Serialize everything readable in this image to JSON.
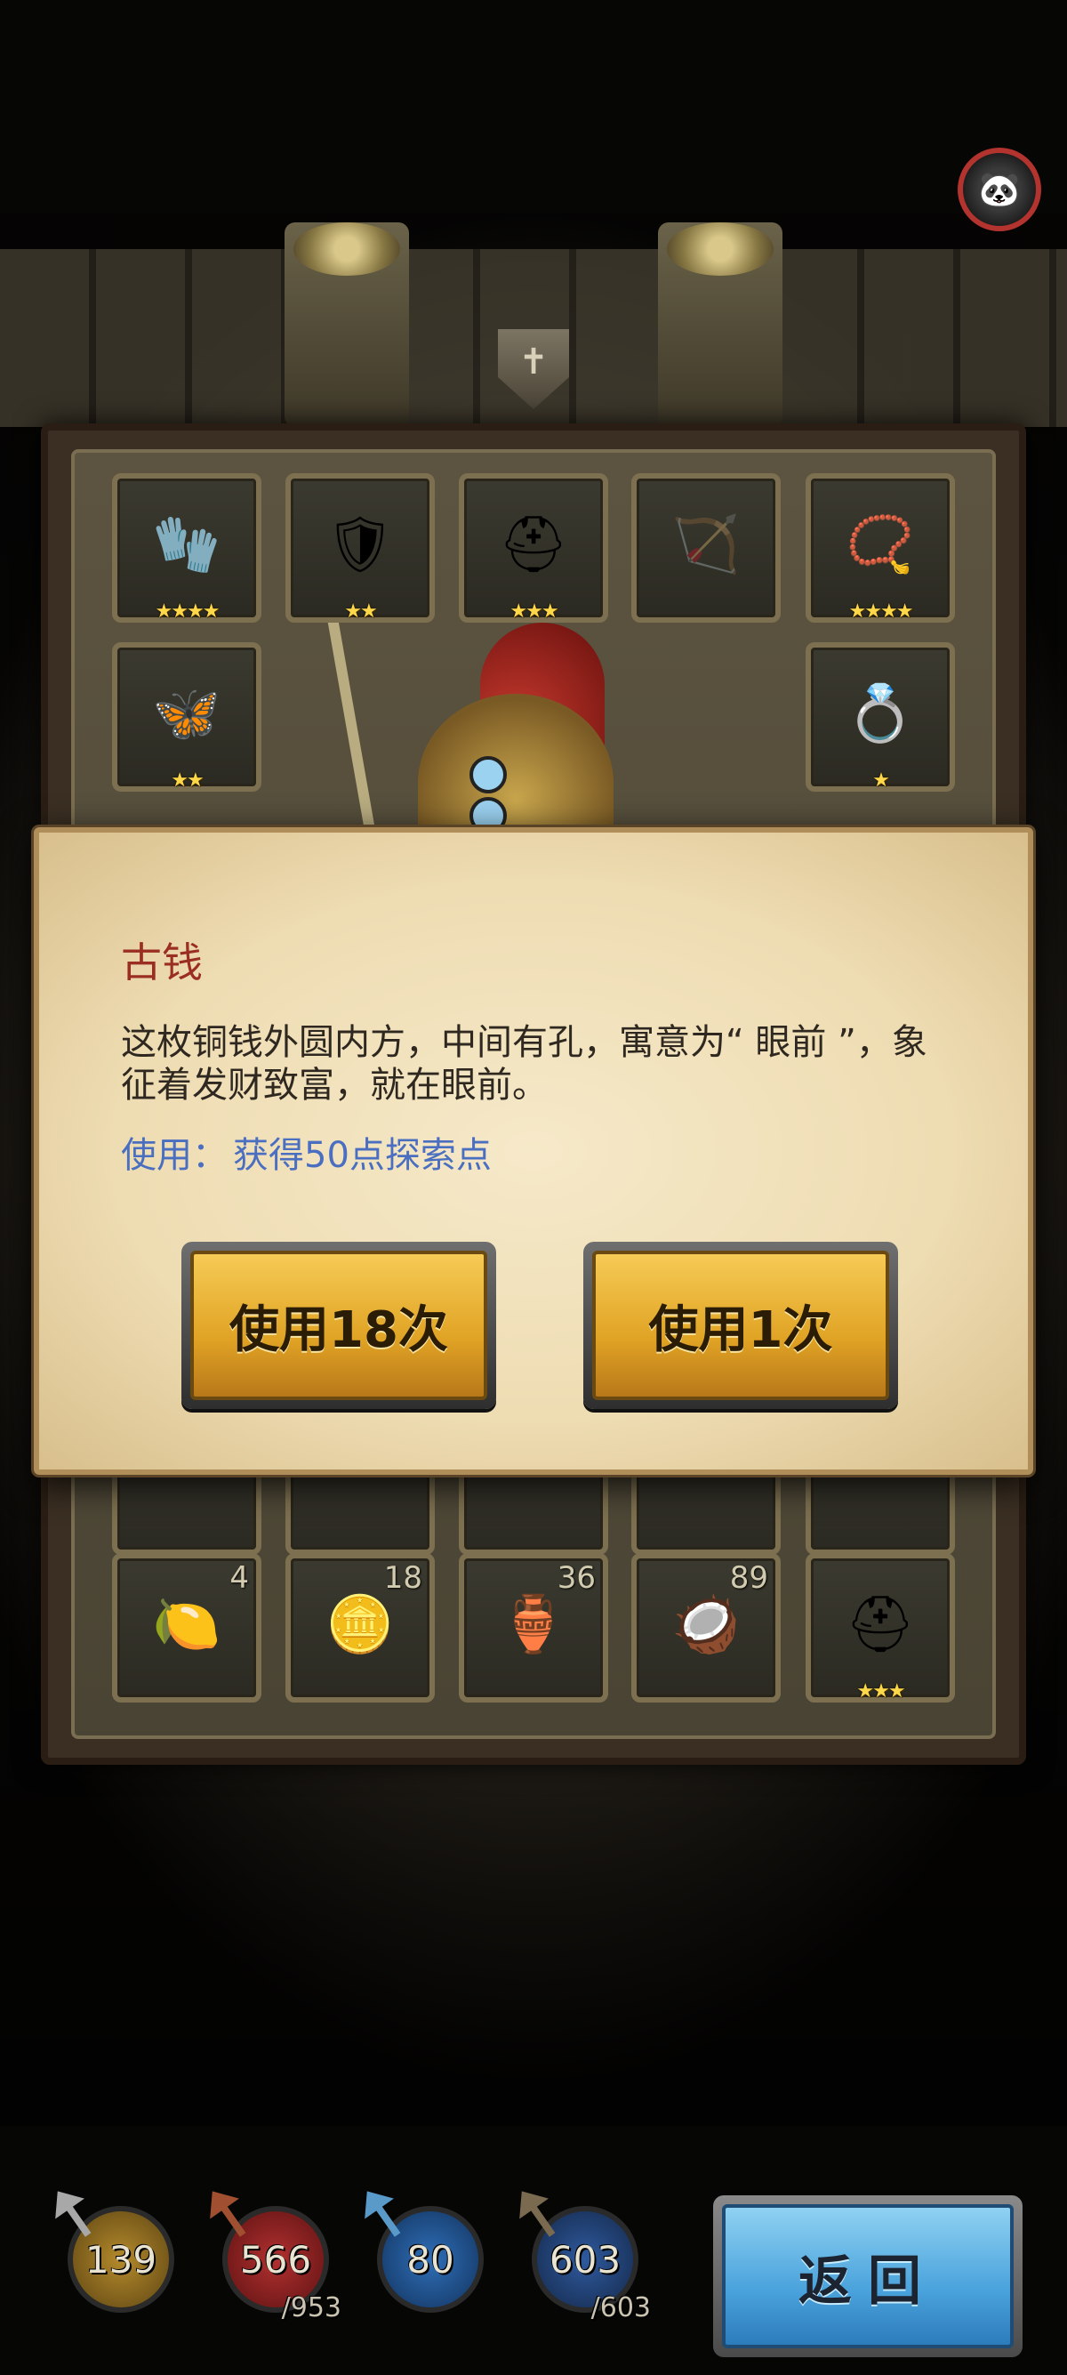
{
  "profile": {
    "icon": "panda-avatar-icon",
    "glyph": "🐼"
  },
  "equipment": [
    {
      "name": "gauntlet-icon",
      "glyph": "🧤",
      "stars": "★★★★"
    },
    {
      "name": "chest-armor-icon",
      "glyph": "🛡",
      "stars": "★★"
    },
    {
      "name": "spartan-helmet-icon",
      "glyph": "⛑",
      "stars": "★★★"
    },
    {
      "name": "crossbow-slot-icon",
      "glyph": "🏹",
      "stars": ""
    },
    {
      "name": "amulet-icon",
      "glyph": "📿",
      "stars": "★★★★"
    },
    {
      "name": "shoulder-armor-icon",
      "glyph": "🦋",
      "stars": "★★"
    },
    {
      "name": "ring-icon",
      "glyph": "💍",
      "stars": "★"
    }
  ],
  "inventory": [
    {
      "name": "buddha-hand-fruit-icon",
      "glyph": "🍋",
      "count": "4",
      "stars": ""
    },
    {
      "name": "ancient-coin-icon",
      "glyph": "🪙",
      "count": "18",
      "stars": ""
    },
    {
      "name": "vase-icon",
      "glyph": "🏺",
      "count": "36",
      "stars": ""
    },
    {
      "name": "bowl-icon",
      "glyph": "🥥",
      "count": "89",
      "stars": ""
    },
    {
      "name": "spartan-helmet-icon",
      "glyph": "⛑",
      "count": "",
      "stars": "★★★"
    }
  ],
  "dialog": {
    "title": "古钱",
    "description": "这枚铜钱外圆内方，中间有孔，寓意为“ 眼前 ”，象征着发财致富，就在眼前。",
    "use_label": "使用：",
    "use_value": "获得50点探索点",
    "btn_use_many": "使用18次",
    "btn_use_one": "使用1次"
  },
  "stats": [
    {
      "name": "attack-stat",
      "value": "139",
      "max": "",
      "color": "#8a6a1e",
      "pin": "#a8a8a8"
    },
    {
      "name": "health-stat",
      "value": "566",
      "max": "/953",
      "color": "#8a1e1e",
      "pin": "#a05030"
    },
    {
      "name": "defense-stat",
      "value": "80",
      "max": "",
      "color": "#1e4a8a",
      "pin": "#5a9ac8"
    },
    {
      "name": "mana-stat",
      "value": "603",
      "max": "/603",
      "color": "#23457a",
      "pin": "#7a6a50"
    }
  ],
  "return_label": "返回"
}
